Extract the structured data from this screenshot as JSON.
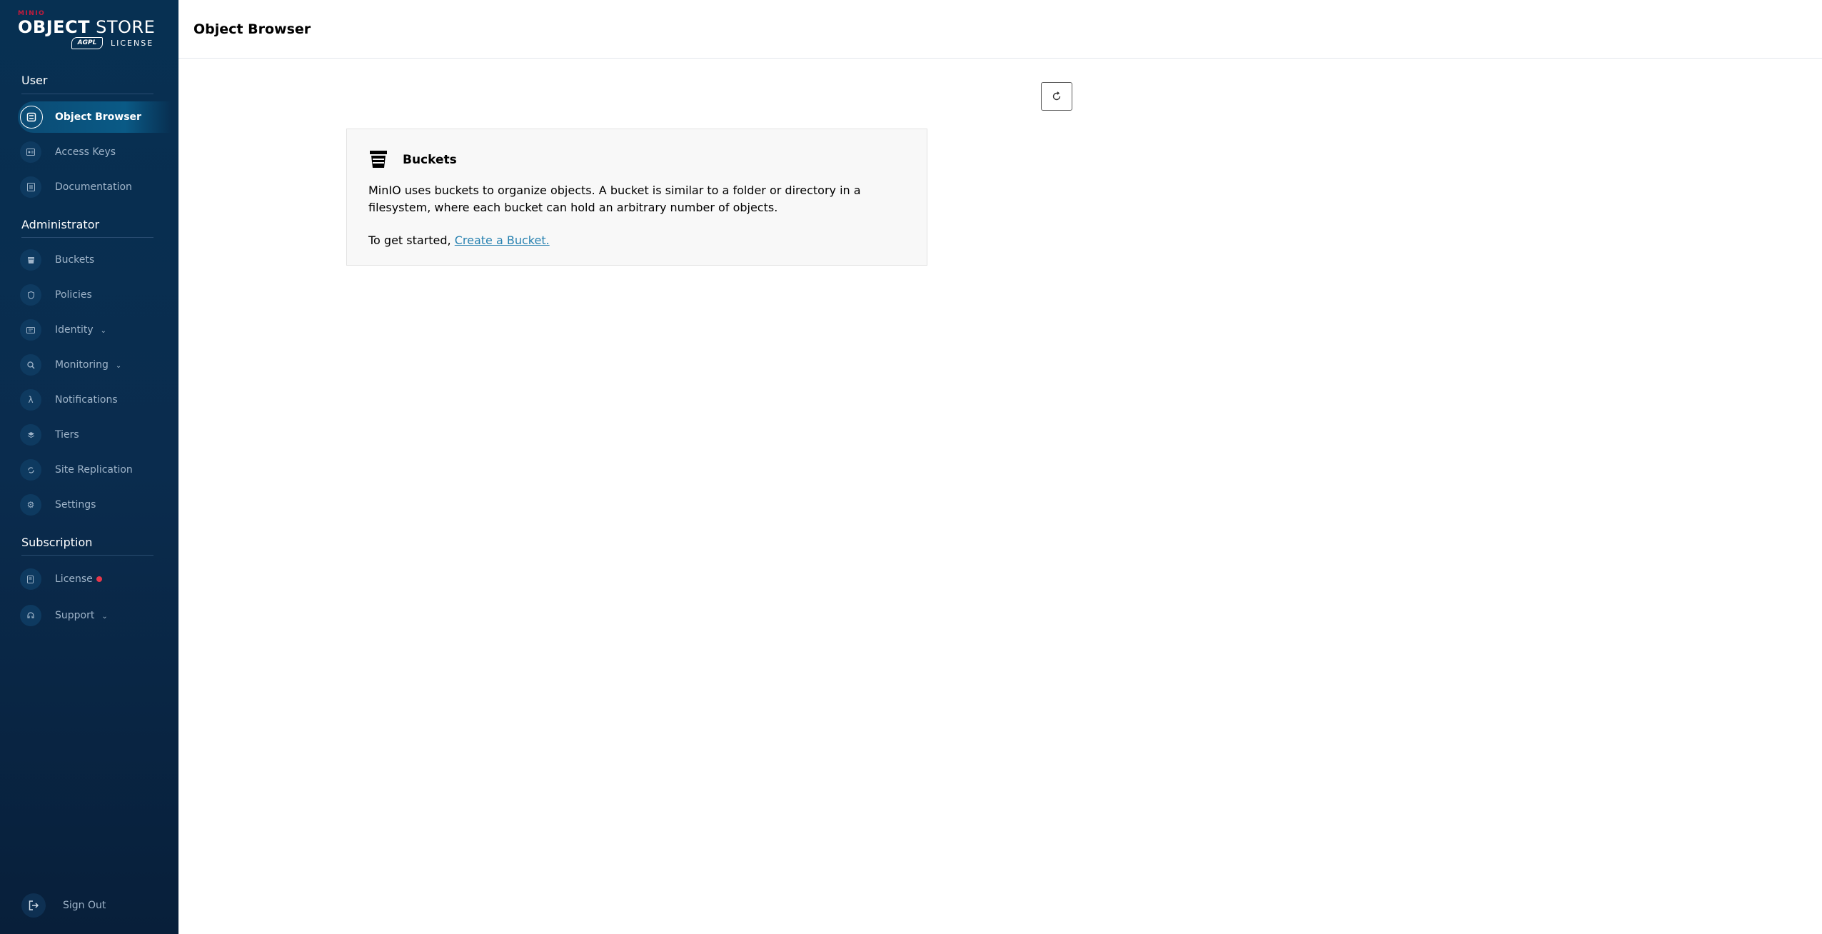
{
  "logo": {
    "brand": "MINIO",
    "product_bold": "OBJECT",
    "product_rest": " STORE",
    "badge": "AGPL",
    "license": "LICENSE"
  },
  "sidebar": {
    "sections": [
      {
        "title": "User"
      },
      {
        "title": "Administrator"
      },
      {
        "title": "Subscription"
      }
    ],
    "user_items": [
      {
        "label": "Object Browser",
        "icon": "object-browser-icon",
        "active": true
      },
      {
        "label": "Access Keys",
        "icon": "key-icon"
      },
      {
        "label": "Documentation",
        "icon": "document-icon"
      }
    ],
    "admin_items": [
      {
        "label": "Buckets",
        "icon": "bucket-icon"
      },
      {
        "label": "Policies",
        "icon": "shield-icon"
      },
      {
        "label": "Identity",
        "icon": "id-card-icon",
        "expandable": true
      },
      {
        "label": "Monitoring",
        "icon": "magnifier-icon",
        "expandable": true
      },
      {
        "label": "Notifications",
        "icon": "lambda-icon"
      },
      {
        "label": "Tiers",
        "icon": "layers-icon"
      },
      {
        "label": "Site Replication",
        "icon": "replication-icon"
      },
      {
        "label": "Settings",
        "icon": "gear-icon"
      }
    ],
    "subscription_items": [
      {
        "label": "License",
        "icon": "license-icon",
        "badge_dot": true
      },
      {
        "label": "Support",
        "icon": "support-icon",
        "expandable": true
      }
    ],
    "sign_out": "Sign Out"
  },
  "header": {
    "title": "Object Browser"
  },
  "card": {
    "title": "Buckets",
    "body": "MinIO uses buckets to organize objects. A bucket is similar to a folder or directory in a filesystem, where each bucket can hold an arbitrary number of objects.",
    "cta_prefix": "To get started, ",
    "cta_link": "Create a Bucket."
  },
  "colors": {
    "sidebar_bg": "#0a2c4e",
    "accent_red": "#e8374a",
    "link": "#2781b0"
  }
}
